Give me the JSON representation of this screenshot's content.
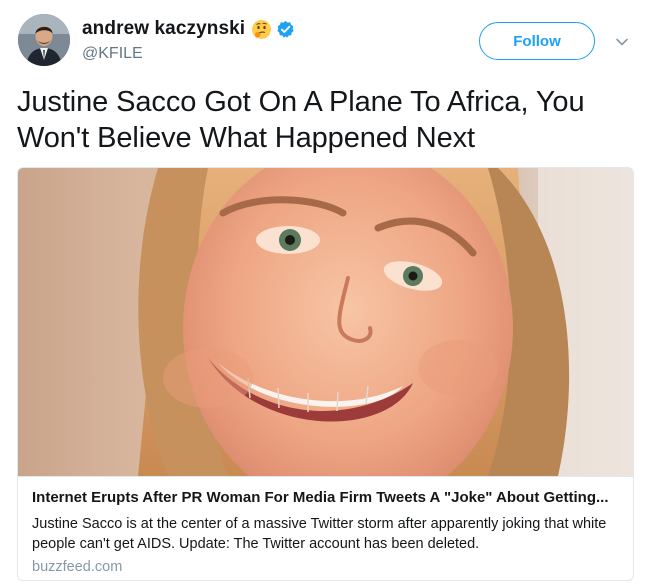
{
  "author": {
    "display_name": "andrew kaczynski",
    "handle": "@KFILE",
    "emoji_icon": "thinking-face-emoji",
    "verified_icon": "verified-badge-icon"
  },
  "actions": {
    "follow_label": "Follow",
    "menu_icon": "chevron-down-icon"
  },
  "tweet": {
    "text": "Justine Sacco Got On A Plane To Africa, You Won't Believe What Happened Next"
  },
  "card": {
    "title": "Internet Erupts After PR Woman For Media Firm Tweets A \"Joke\" About Getting...",
    "description": "Justine Sacco is at the center of a massive Twitter storm after apparently joking that white people can't get AIDS. Update: The Twitter account has been deleted.",
    "domain": "buzzfeed.com"
  },
  "colors": {
    "accent": "#1da1f2",
    "text": "#14171a",
    "secondary": "#657786",
    "border": "#e1e8ed"
  }
}
